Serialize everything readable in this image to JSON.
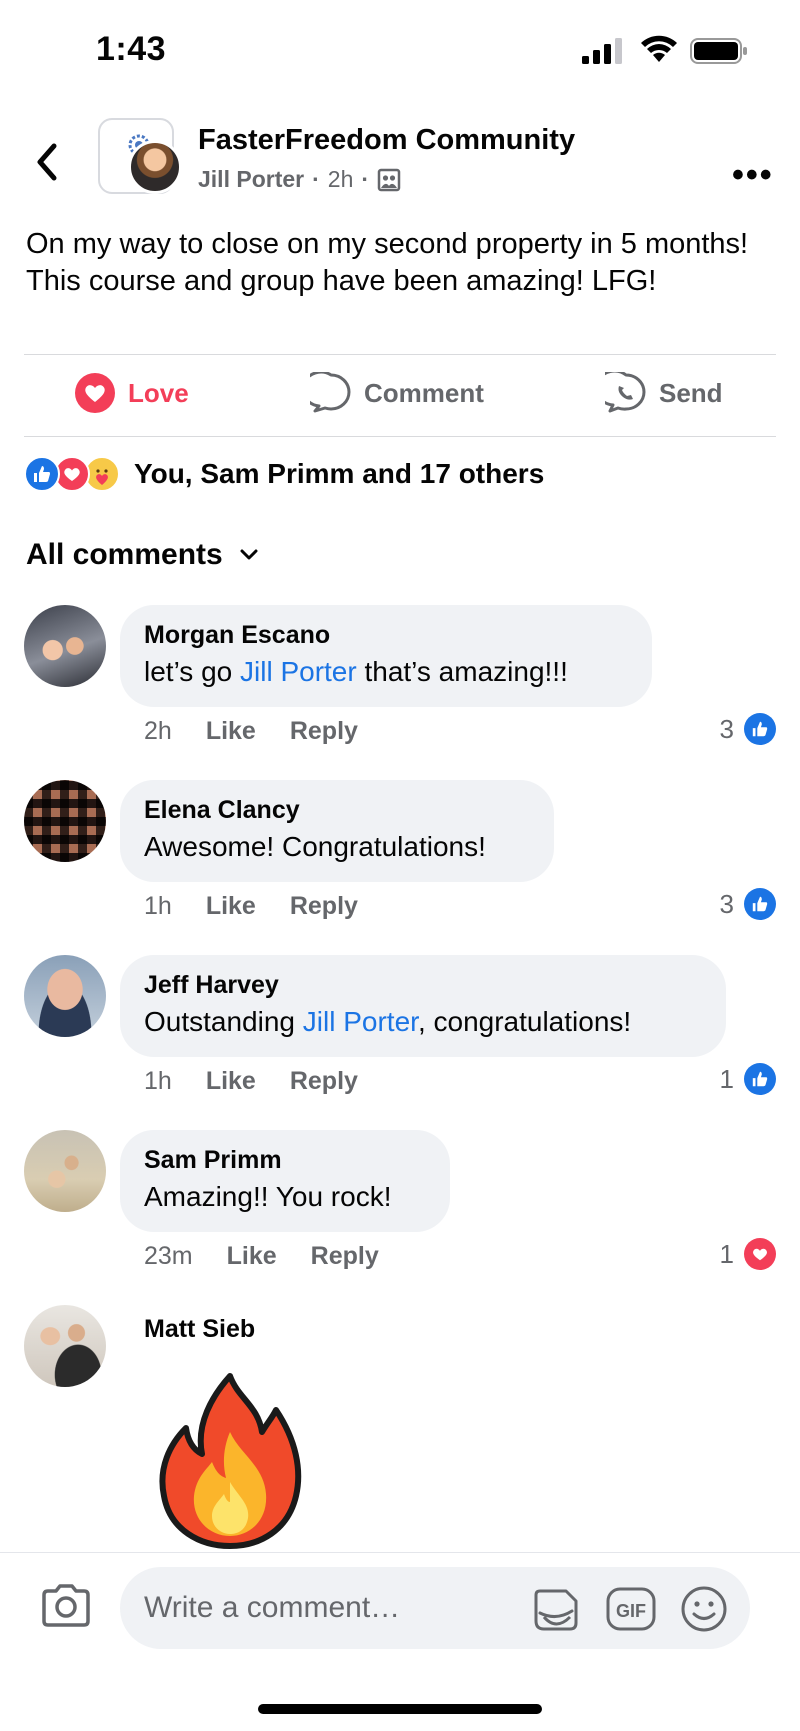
{
  "status_bar": {
    "time": "1:43"
  },
  "header": {
    "group_name": "FasterFreedom Community",
    "author": "Jill Porter",
    "time": "2h",
    "separator": "·"
  },
  "post": {
    "text": "On my way to close on my second property in 5 months! This course and group have been amazing! LFG!"
  },
  "actions": {
    "love_label": "Love",
    "comment_label": "Comment",
    "send_label": "Send"
  },
  "reactions": {
    "summary": "You, Sam Primm and 17 others"
  },
  "comments_section": {
    "filter_label": "All comments"
  },
  "comments": [
    {
      "name": "Morgan Escano",
      "text_before": "let’s go ",
      "tag": "Jill Porter",
      "text_after": " that’s amazing!!!",
      "time": "2h",
      "like": "Like",
      "reply": "Reply",
      "count": "3",
      "reaction": "like"
    },
    {
      "name": "Elena Clancy",
      "text_before": "Awesome! Congratulations!",
      "tag": "",
      "text_after": "",
      "time": "1h",
      "like": "Like",
      "reply": "Reply",
      "count": "3",
      "reaction": "like"
    },
    {
      "name": "Jeff Harvey",
      "text_before": "Outstanding ",
      "tag": "Jill Porter",
      "text_after": ", congratulations!",
      "time": "1h",
      "like": "Like",
      "reply": "Reply",
      "count": "1",
      "reaction": "like"
    },
    {
      "name": "Sam Primm",
      "text_before": "Amazing!! You rock!",
      "tag": "",
      "text_after": "",
      "time": "23m",
      "like": "Like",
      "reply": "Reply",
      "count": "1",
      "reaction": "love"
    },
    {
      "name": "Matt Sieb",
      "sticker": "fire-emoji-icon"
    }
  ],
  "composer": {
    "placeholder": "Write a comment…",
    "gif_label": "GIF"
  },
  "colors": {
    "accent_blue": "#1b74e4",
    "love_red": "#f33e58",
    "muted": "#65676b",
    "bubble": "#f0f2f5"
  }
}
